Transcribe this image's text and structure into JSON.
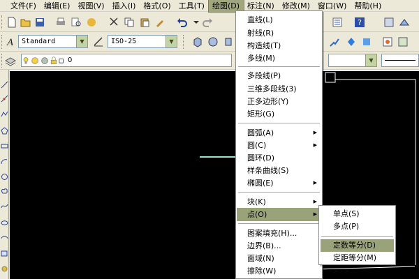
{
  "menubar": {
    "items": [
      {
        "label": "文件(F)",
        "active": false
      },
      {
        "label": "编辑(E)",
        "active": false
      },
      {
        "label": "视图(V)",
        "active": false
      },
      {
        "label": "插入(I)",
        "active": false
      },
      {
        "label": "格式(O)",
        "active": false
      },
      {
        "label": "工具(T)",
        "active": false
      },
      {
        "label": "绘图(D)",
        "active": true
      },
      {
        "label": "标注(N)",
        "active": false
      },
      {
        "label": "修改(M)",
        "active": false
      },
      {
        "label": "窗口(W)",
        "active": false
      },
      {
        "label": "帮助(H)",
        "active": false
      }
    ]
  },
  "styles_toolbar": {
    "text_style": "Standard",
    "dim_style": "ISO-25"
  },
  "layers_toolbar": {
    "layer_name": "0"
  },
  "draw_menu": {
    "items": [
      {
        "label": "直线(L)",
        "submenu": false
      },
      {
        "label": "射线(R)",
        "submenu": false
      },
      {
        "label": "构造线(T)",
        "submenu": false
      },
      {
        "label": "多线(M)",
        "submenu": false
      },
      {
        "label": "多段线(P)",
        "submenu": false
      },
      {
        "label": "三维多段线(3)",
        "submenu": false
      },
      {
        "label": "正多边形(Y)",
        "submenu": false
      },
      {
        "label": "矩形(G)",
        "submenu": false
      },
      {
        "label": "圆弧(A)",
        "submenu": true
      },
      {
        "label": "圆(C)",
        "submenu": true
      },
      {
        "label": "圆环(D)",
        "submenu": false
      },
      {
        "label": "样条曲线(S)",
        "submenu": false
      },
      {
        "label": "椭圆(E)",
        "submenu": true
      },
      {
        "label": "块(K)",
        "submenu": true
      },
      {
        "label": "点(O)",
        "submenu": true,
        "highlighted": true
      },
      {
        "label": "图案填充(H)...",
        "submenu": false
      },
      {
        "label": "边界(B)...",
        "submenu": false
      },
      {
        "label": "面域(N)",
        "submenu": false
      },
      {
        "label": "擦除(W)",
        "submenu": false
      }
    ]
  },
  "point_submenu": {
    "items": [
      {
        "label": "单点(S)"
      },
      {
        "label": "多点(P)"
      },
      {
        "label": "定数等分(D)",
        "highlighted": true
      },
      {
        "label": "定距等分(M)"
      }
    ]
  },
  "colors": {
    "menu_highlight": "#9aa27a",
    "canvas": "#000000",
    "toolbar": "#ece9d8"
  }
}
